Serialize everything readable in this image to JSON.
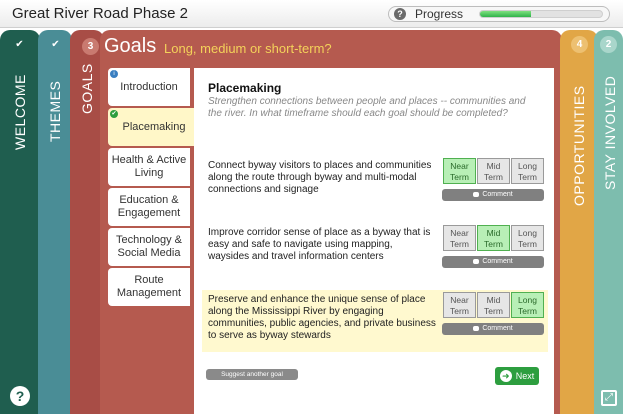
{
  "app": {
    "title": "Great River Road Phase 2"
  },
  "progress": {
    "label": "Progress",
    "value": 0.42
  },
  "tabs": {
    "welcome": {
      "label": "WELCOME",
      "badge": "✔"
    },
    "themes": {
      "label": "THEMES",
      "badge": "✔"
    },
    "goals": {
      "label": "GOALS",
      "badge": "3"
    },
    "opportunities": {
      "label": "OPPORTUNITIES",
      "badge": "4"
    },
    "stay_involved": {
      "label": "STAY INVOLVED",
      "badge": "2"
    }
  },
  "goals_panel": {
    "title": "Goals",
    "subtitle": "Long, medium or short-term?"
  },
  "goal_list": [
    {
      "label": "Introduction",
      "badge": "i"
    },
    {
      "label": "Placemaking",
      "badge": "✔"
    },
    {
      "label": "Health & Active Living"
    },
    {
      "label": "Education & Engagement"
    },
    {
      "label": "Technology & Social Media"
    },
    {
      "label": "Route Management"
    }
  ],
  "content": {
    "title": "Placemaking",
    "description": "Strengthen connections between people and places -- communities and the river. In what timeframe should each goal should be completed?",
    "goals": [
      {
        "text": "Connect byway visitors to places and communities along the route through byway and multi-modal connections and signage",
        "selected": "Near Term"
      },
      {
        "text": "Improve corridor sense of place as a byway that is easy and safe to navigate using mapping, waysides and travel information centers",
        "selected": "Mid Term"
      },
      {
        "text": "Preserve and enhance the unique sense of place along the Mississippi River by engaging communities, public agencies, and private business to serve as byway stewards",
        "selected": "Long Term"
      }
    ],
    "term_labels": {
      "near": "Near Term",
      "mid": "Mid Term",
      "long": "Long Term"
    },
    "comment_label": "Comment",
    "suggest_label": "Suggest another goal",
    "next_label": "Next"
  },
  "colors": {
    "welcome": "#1f5e4f",
    "themes": "#4a8d96",
    "goals": "#b55a4f",
    "opportunities": "#e1a646",
    "stay_involved": "#7dbdae",
    "selected_term": "#b8efb6",
    "next_button": "#2d9e3f"
  },
  "icons": {
    "help": "question-circle-icon",
    "expand": "expand-icon",
    "progress_help": "question-icon"
  }
}
